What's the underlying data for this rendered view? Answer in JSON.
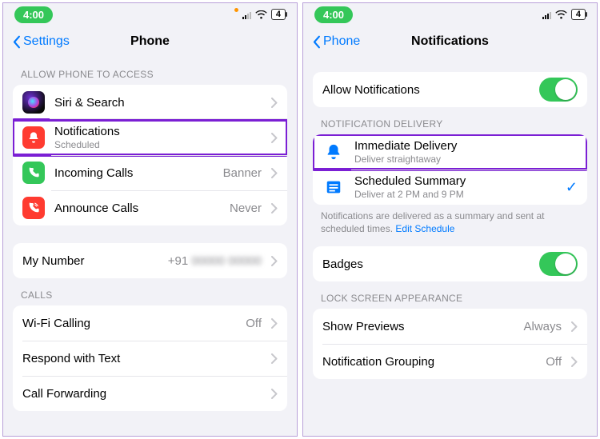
{
  "left": {
    "status": {
      "time": "4:00",
      "battery": "4"
    },
    "nav": {
      "back": "Settings",
      "title": "Phone"
    },
    "sec1_header": "ALLOW PHONE TO ACCESS",
    "rows1": {
      "siri": {
        "title": "Siri & Search"
      },
      "notif": {
        "title": "Notifications",
        "sub": "Scheduled"
      },
      "incoming": {
        "title": "Incoming Calls",
        "value": "Banner"
      },
      "announce": {
        "title": "Announce Calls",
        "value": "Never"
      }
    },
    "rows2": {
      "mynum": {
        "title": "My Number",
        "value": "+91"
      }
    },
    "sec3_header": "CALLS",
    "rows3": {
      "wifi": {
        "title": "Wi-Fi Calling",
        "value": "Off"
      },
      "respond": {
        "title": "Respond with Text"
      },
      "forward": {
        "title": "Call Forwarding"
      }
    }
  },
  "right": {
    "status": {
      "time": "4:00",
      "battery": "4"
    },
    "nav": {
      "back": "Phone",
      "title": "Notifications"
    },
    "allow_label": "Allow Notifications",
    "sec_delivery": "NOTIFICATION DELIVERY",
    "delivery": {
      "immediate": {
        "title": "Immediate Delivery",
        "sub": "Deliver straightaway"
      },
      "scheduled": {
        "title": "Scheduled Summary",
        "sub": "Deliver at 2 PM and 9 PM"
      }
    },
    "delivery_footer_text": "Notifications are delivered as a summary and sent at scheduled times. ",
    "delivery_footer_link": "Edit Schedule",
    "badges_label": "Badges",
    "sec_lock": "LOCK SCREEN APPEARANCE",
    "lock": {
      "previews": {
        "title": "Show Previews",
        "value": "Always"
      },
      "grouping": {
        "title": "Notification Grouping",
        "value": "Off"
      }
    }
  }
}
